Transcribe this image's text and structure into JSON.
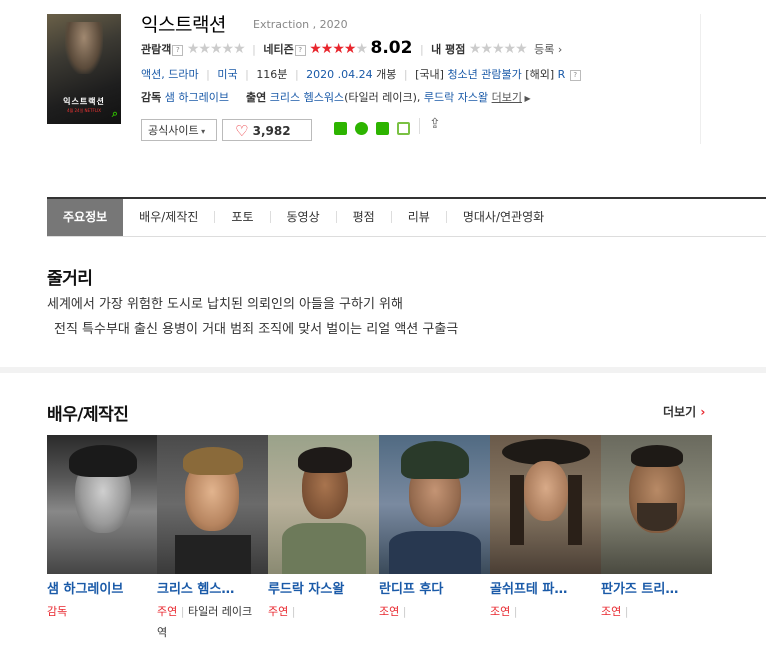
{
  "movie": {
    "title": "익스트랙션",
    "original_title": "Extraction , 2020",
    "poster_title": "익스트랙션",
    "poster_sub": "4월 24일 NETFLIX",
    "ratings": {
      "audience_label": "관람객",
      "netizen_label": "네티즌",
      "netizen_score": "8.02",
      "my_label": "내 평점",
      "register": "등록"
    },
    "info": {
      "genre1": "액션",
      "genre2": "드라마",
      "country": "미국",
      "runtime": "116분",
      "release": "2020 .04.24",
      "release_suffix": "개봉",
      "grade_domestic_label": "[국내]",
      "grade_domestic": "청소년 관람불가",
      "grade_foreign_label": "[해외]",
      "grade_foreign": "R"
    },
    "director_label": "감독",
    "director": "샘 하그레이브",
    "cast_label": "출연",
    "cast_main": "크리스 헴스워스",
    "cast_role": "(타일러 레이크),",
    "cast_second": "루드락 자스왈",
    "more_link": "더보기"
  },
  "buttons": {
    "official_site": "공식사이트",
    "likes": "3,982"
  },
  "tabs": [
    "주요정보",
    "배우/제작진",
    "포토",
    "동영상",
    "평점",
    "리뷰",
    "명대사/연관영화"
  ],
  "synopsis": {
    "heading": "줄거리",
    "line1": "세계에서 가장 위험한 도시로 납치된 의뢰인의 아들을 구하기 위해",
    "line2": "전직 특수부대 출신 용병이 거대 범죄 조직에 맞서 벌이는 리얼 액션 구출극"
  },
  "cast_section": {
    "heading": "배우/제작진",
    "more": "더보기",
    "people": [
      {
        "name": "샘 하그레이브",
        "role": "감독",
        "character": ""
      },
      {
        "name": "크리스 헴스…",
        "role": "주연",
        "character": "타일러 레이크 역"
      },
      {
        "name": "루드락 자스왈",
        "role": "주연",
        "character": ""
      },
      {
        "name": "란디프 후다",
        "role": "조연",
        "character": ""
      },
      {
        "name": "골쉬프테 파…",
        "role": "조연",
        "character": ""
      },
      {
        "name": "판가즈 트리…",
        "role": "조연",
        "character": ""
      }
    ]
  },
  "colors": {
    "accent_red": "#e8262d",
    "link_blue": "#1a5aa8",
    "tab_active": "#777777",
    "naver_green": "#2db400"
  }
}
